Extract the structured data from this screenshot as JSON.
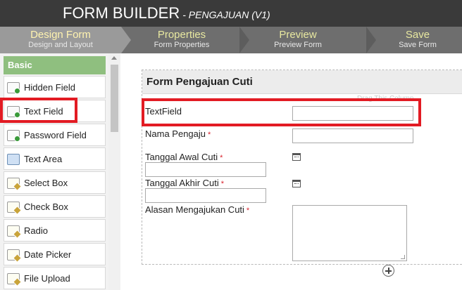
{
  "app": {
    "title": "FORM BUILDER",
    "subtitle": "- PENGAJUAN (V1)"
  },
  "steps": [
    {
      "label": "Design Form",
      "sub": "Design and Layout",
      "active": true
    },
    {
      "label": "Properties",
      "sub": "Form Properties",
      "active": false
    },
    {
      "label": "Preview",
      "sub": "Preview Form",
      "active": false
    },
    {
      "label": "Save",
      "sub": "Save Form",
      "active": false
    }
  ],
  "palette": {
    "category": "Basic",
    "items": [
      {
        "label": "Hidden Field",
        "icon": "hidden-field-icon"
      },
      {
        "label": "Text Field",
        "icon": "text-field-icon"
      },
      {
        "label": "Password Field",
        "icon": "password-field-icon"
      },
      {
        "label": "Text Area",
        "icon": "text-area-icon"
      },
      {
        "label": "Select Box",
        "icon": "select-box-icon"
      },
      {
        "label": "Check Box",
        "icon": "check-box-icon"
      },
      {
        "label": "Radio",
        "icon": "radio-icon"
      },
      {
        "label": "Date Picker",
        "icon": "date-picker-icon"
      },
      {
        "label": "File Upload",
        "icon": "file-upload-icon"
      }
    ]
  },
  "form": {
    "title": "Form Pengajuan Cuti",
    "drag_hint": "Drag This Column",
    "fields": [
      {
        "label": "TextField",
        "required": false
      },
      {
        "label": "Nama Pengaju",
        "required": true
      },
      {
        "label": "Tanggal Awal Cuti",
        "required": true
      },
      {
        "label": "Tanggal Akhir Cuti",
        "required": true
      },
      {
        "label": "Alasan Mengajukan Cuti",
        "required": true
      }
    ],
    "required_mark": "*"
  },
  "colors": {
    "highlight": "#e21b23",
    "category": "#8fbf7f",
    "titlebar": "#3a3a3a"
  }
}
